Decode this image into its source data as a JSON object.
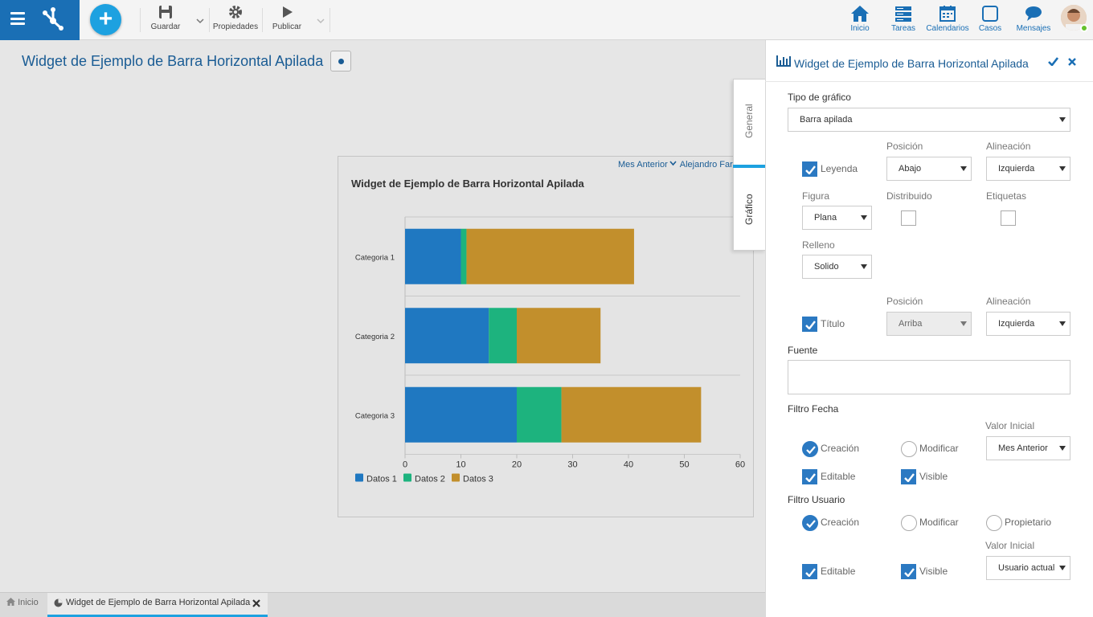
{
  "toolbar": {
    "save_label": "Guardar",
    "properties_label": "Propiedades",
    "publish_label": "Publicar"
  },
  "nav": {
    "home": "Inicio",
    "tasks": "Tareas",
    "calendars": "Calendarios",
    "cases": "Casos",
    "messages": "Mensajes"
  },
  "page": {
    "title": "Widget de Ejemplo de Barra Horizontal Apilada"
  },
  "widget": {
    "title": "Widget de Ejemplo de Barra Horizontal Apilada",
    "date_filter": "Mes Anterior",
    "user_filter": "Alejandro Fari"
  },
  "chart_data": {
    "type": "bar",
    "orientation": "horizontal",
    "stacked": true,
    "title": "Widget de Ejemplo de Barra Horizontal Apilada",
    "categories": [
      "Categoria 1",
      "Categoria 2",
      "Categoria 3"
    ],
    "series": [
      {
        "name": "Datos 1",
        "values": [
          10,
          15,
          20
        ],
        "color": "#1f78c1"
      },
      {
        "name": "Datos 2",
        "values": [
          1,
          5,
          8
        ],
        "color": "#1db37e"
      },
      {
        "name": "Datos 3",
        "values": [
          30,
          15,
          25
        ],
        "color": "#c28f2c"
      }
    ],
    "x_ticks": [
      "0",
      "10",
      "20",
      "30",
      "40",
      "50",
      "60"
    ],
    "xlim": [
      0,
      60
    ],
    "legend_position": "bottom-left",
    "grid": true
  },
  "tabs": {
    "home": "Inicio",
    "widget": "Widget de Ejemplo de Barra Horizontal Apilada"
  },
  "side_tabs": {
    "general": "General",
    "grafico": "Gráfico"
  },
  "panel": {
    "title": "Widget de Ejemplo de Barra Horizontal Apilada",
    "chart_type_label": "Tipo de gráfico",
    "chart_type_value": "Barra apilada",
    "position_label": "Posición",
    "alignment_label": "Alineación",
    "legend_label": "Leyenda",
    "legend_position": "Abajo",
    "legend_alignment": "Izquierda",
    "shape_label": "Figura",
    "shape_value": "Plana",
    "distributed_label": "Distribuido",
    "labels_label": "Etiquetas",
    "fill_label": "Relleno",
    "fill_value": "Solido",
    "title_label": "Título",
    "title_position": "Arriba",
    "title_alignment": "Izquierda",
    "source_label": "Fuente",
    "date_filter_label": "Filtro Fecha",
    "initial_value_label": "Valor Inicial",
    "creation_label": "Creación",
    "modify_label": "Modificar",
    "date_initial_value": "Mes Anterior",
    "editable_label": "Editable",
    "visible_label": "Visible",
    "user_filter_label": "Filtro Usuario",
    "owner_label": "Propietario",
    "user_initial_value": "Usuario actual"
  }
}
